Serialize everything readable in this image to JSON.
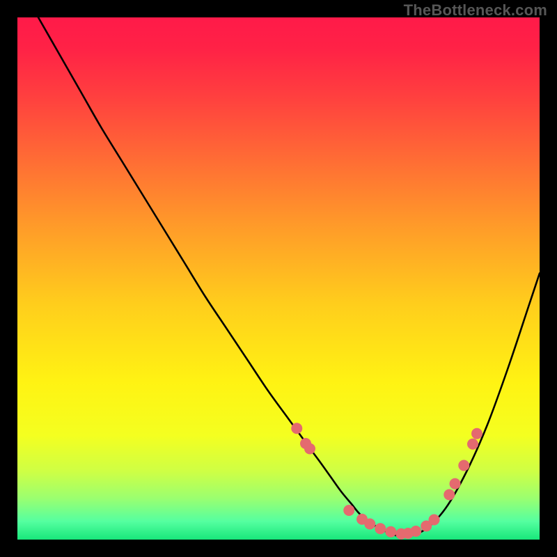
{
  "watermark": {
    "text": "TheBottleneck.com"
  },
  "gradient": {
    "stops": [
      {
        "offset": 0.0,
        "color": "#ff1a49"
      },
      {
        "offset": 0.06,
        "color": "#ff2246"
      },
      {
        "offset": 0.15,
        "color": "#ff3f3f"
      },
      {
        "offset": 0.28,
        "color": "#ff6f34"
      },
      {
        "offset": 0.4,
        "color": "#ff9b29"
      },
      {
        "offset": 0.55,
        "color": "#ffce1c"
      },
      {
        "offset": 0.7,
        "color": "#fff313"
      },
      {
        "offset": 0.8,
        "color": "#f4ff20"
      },
      {
        "offset": 0.87,
        "color": "#ceff45"
      },
      {
        "offset": 0.92,
        "color": "#9cff6f"
      },
      {
        "offset": 0.965,
        "color": "#55ffa0"
      },
      {
        "offset": 1.0,
        "color": "#18e77b"
      }
    ]
  },
  "chart_data": {
    "type": "line",
    "title": "",
    "xlabel": "",
    "ylabel": "",
    "xlim": [
      0,
      100
    ],
    "ylim": [
      0,
      100
    ],
    "series": [
      {
        "name": "curve",
        "x": [
          4,
          8,
          12,
          16,
          20,
          24,
          28,
          32,
          36,
          40,
          44,
          48,
          52,
          56,
          58,
          60,
          62,
          64,
          66,
          70,
          74,
          78,
          82,
          86,
          90,
          94,
          98,
          100
        ],
        "y": [
          100,
          93,
          86,
          79,
          72.5,
          66,
          59.5,
          53,
          46.5,
          40.5,
          34.5,
          28.5,
          23,
          17.5,
          14.8,
          12,
          9.2,
          6.8,
          4.5,
          1.8,
          0.6,
          1.9,
          6,
          13,
          22,
          33,
          45,
          51
        ]
      }
    ],
    "markers": {
      "name": "dots",
      "color": "#e46a6f",
      "radius_px": 8,
      "points": [
        {
          "x": 53.5,
          "y": 21.3
        },
        {
          "x": 55.2,
          "y": 18.4
        },
        {
          "x": 56.0,
          "y": 17.4
        },
        {
          "x": 63.5,
          "y": 5.6
        },
        {
          "x": 66.0,
          "y": 3.9
        },
        {
          "x": 67.5,
          "y": 3.0
        },
        {
          "x": 69.5,
          "y": 2.1
        },
        {
          "x": 71.5,
          "y": 1.5
        },
        {
          "x": 73.5,
          "y": 1.1
        },
        {
          "x": 74.8,
          "y": 1.2
        },
        {
          "x": 76.3,
          "y": 1.6
        },
        {
          "x": 78.3,
          "y": 2.6
        },
        {
          "x": 79.8,
          "y": 3.8
        },
        {
          "x": 82.7,
          "y": 8.6
        },
        {
          "x": 83.8,
          "y": 10.7
        },
        {
          "x": 85.5,
          "y": 14.2
        },
        {
          "x": 87.2,
          "y": 18.3
        },
        {
          "x": 88.0,
          "y": 20.3
        }
      ]
    }
  }
}
